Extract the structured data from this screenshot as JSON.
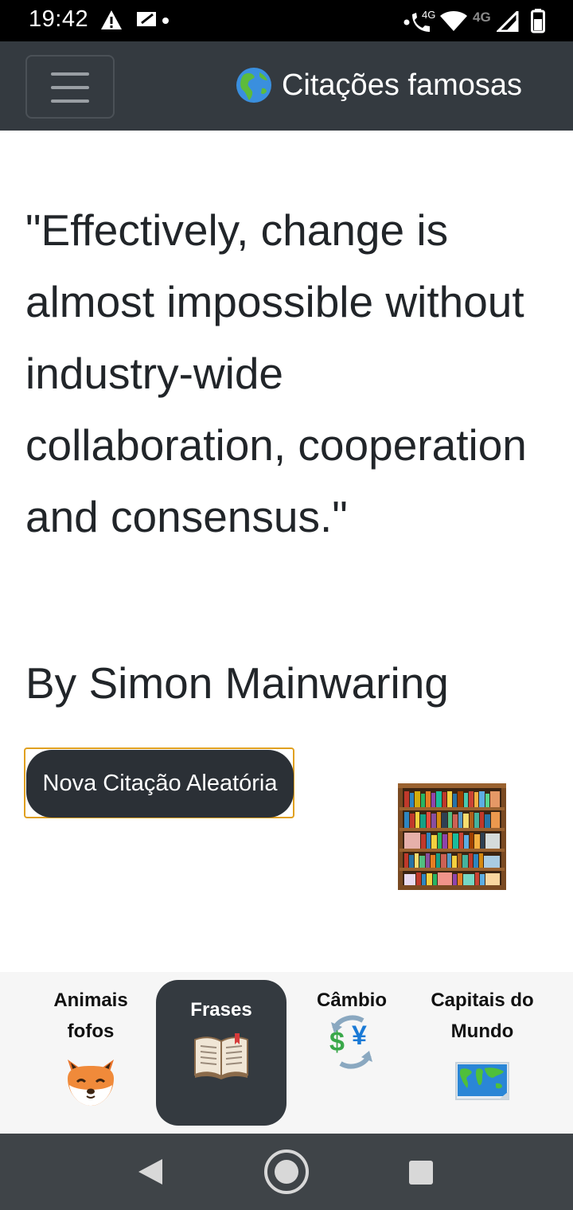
{
  "status_bar": {
    "time": "19:42",
    "network_label_1": "4G",
    "network_label_2": "4G"
  },
  "app_bar": {
    "title": "Citações famosas",
    "globe_icon": "globe-americas-icon"
  },
  "quote": {
    "text": "\"Effectively, change is almost impossible without industry-wide collaboration, cooperation and consensus.\"",
    "author": "By Simon Mainwaring"
  },
  "actions": {
    "random_button_label": "Nova Citação Aleatória"
  },
  "tabs": [
    {
      "label_line1": "Animais",
      "label_line2": "fofos",
      "icon": "fox-icon",
      "active": false
    },
    {
      "label_line1": "Frases",
      "label_line2": "",
      "icon": "open-book-icon",
      "active": true
    },
    {
      "label_line1": "Câmbio",
      "label_line2": "",
      "icon": "currency-exchange-icon",
      "active": false
    },
    {
      "label_line1": "Capitais do",
      "label_line2": "Mundo",
      "icon": "world-map-icon",
      "active": false
    }
  ],
  "colors": {
    "app_bar": "#343a40",
    "button_bg": "#2b3036",
    "button_outline": "#e0a020",
    "tab_bar": "#f6f6f6",
    "nav_bar": "#3f4448"
  }
}
